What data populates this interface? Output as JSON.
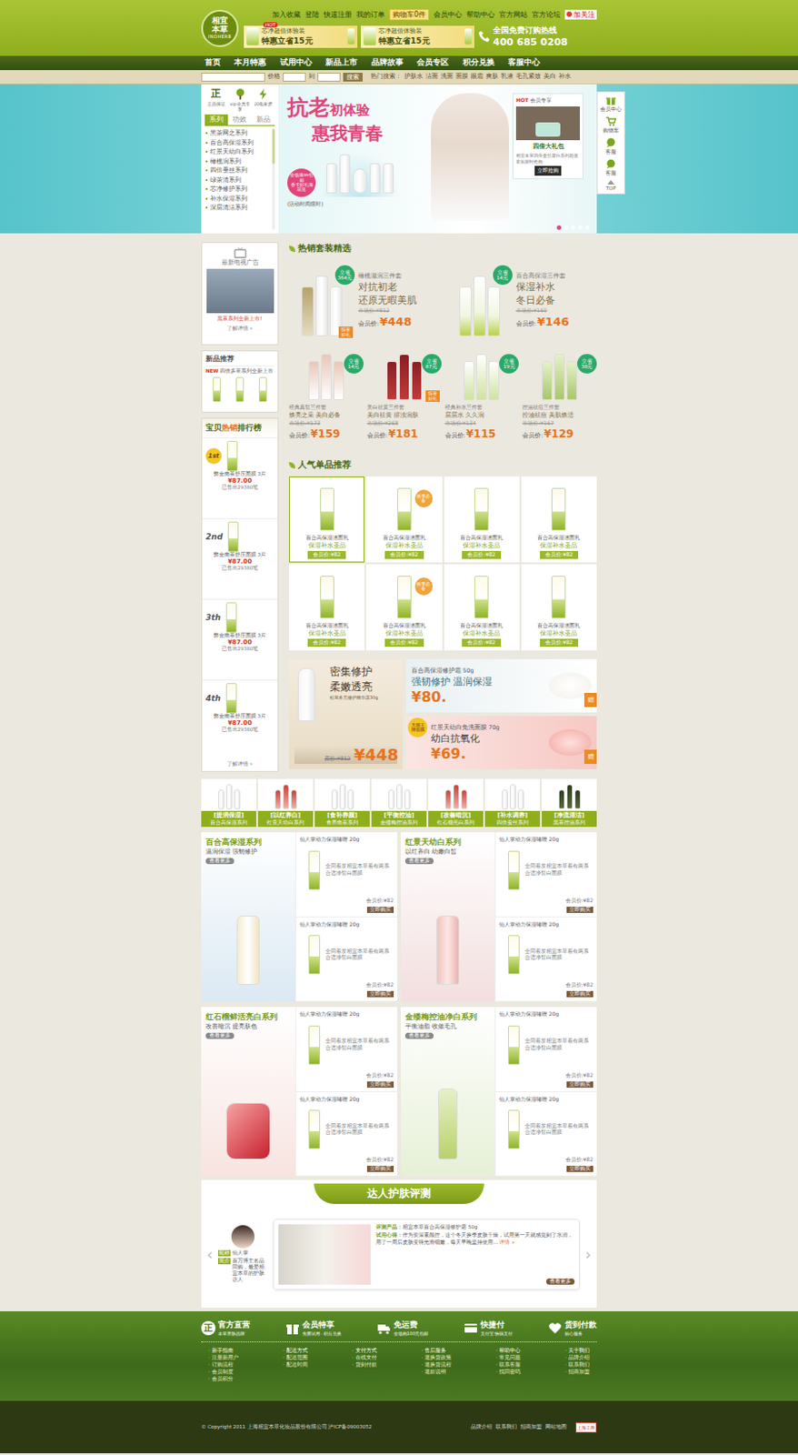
{
  "header": {
    "logo": {
      "name": "相宜本草",
      "latin": "INOHERB"
    },
    "top_links": [
      "加入收藏",
      "登陆",
      "快速注册",
      "我的订单"
    ],
    "cart": "购物车0件",
    "more_links": [
      "会员中心",
      "帮助中心",
      "官方网站",
      "官方论坛"
    ],
    "weibo": "加关注",
    "promos": [
      {
        "badge": "HOT",
        "line1": "芯净超值体验装",
        "line2": "特惠立省15元"
      },
      {
        "badge": "",
        "line1": "芯净超值体验装",
        "line2": "特惠立省15元"
      }
    ],
    "hotline_label": "全国免费订购热线",
    "hotline": "400 685 0208"
  },
  "nav": [
    "首页",
    "本月特惠",
    "试用中心",
    "新品上市",
    "品牌故事",
    "会员专区",
    "积分兑换",
    "客服中心"
  ],
  "search": {
    "price_label": "价格",
    "to": "到",
    "button": "搜索",
    "hot_label": "热门搜索：",
    "hot": [
      "护肤水",
      "洁面",
      "洗面",
      "面膜",
      "眼霜",
      "爽肤",
      "乳液",
      "毛孔紧致",
      "美白",
      "补水"
    ]
  },
  "hero": {
    "guarantees": [
      {
        "kind": "seal",
        "mark": "正",
        "label": "正品保证"
      },
      {
        "kind": "tree",
        "mark": "",
        "label": "vip会员专享"
      },
      {
        "kind": "bolt",
        "mark": "",
        "label": "闪电发货"
      }
    ],
    "tabs": [
      {
        "label": "系列",
        "selected": true
      },
      {
        "label": "功效",
        "selected": false
      },
      {
        "label": "新品",
        "selected": false
      }
    ],
    "series": [
      "黑茶网之系列",
      "百合高保湿系列",
      "红景天幼白系列",
      "橄榄润系列",
      "四倍蚕丝系列",
      "绿茶清系列",
      "芯净修护系列",
      "补水保湿系列",
      "深层清洁系列"
    ],
    "title_a": "抗老",
    "title_b": "初体验",
    "title_c": "惠我青春",
    "sticker": "全场满99包邮",
    "sticker_b": "香卡好礼满就送",
    "note": "(活动时间限时)",
    "card": {
      "hot": "HOT",
      "tag": "会员专享",
      "title": "四倍大礼包",
      "desc": "相宜本草四倍蚕丝凝白系列超值套装限时抢购",
      "button": "立即抢购"
    },
    "dots": [
      {
        "selected": true
      },
      {
        "selected": false
      },
      {
        "selected": false
      },
      {
        "selected": false
      },
      {
        "selected": false
      }
    ]
  },
  "toolbar": [
    {
      "kind": "member",
      "label": "会员中心"
    },
    {
      "kind": "cart",
      "label": "购物车"
    },
    {
      "kind": "chat",
      "label": "客服"
    },
    {
      "kind": "chat",
      "label": "客服"
    },
    {
      "kind": "top",
      "label": "TOP"
    }
  ],
  "sidebar": {
    "tv": {
      "title": "最新电视广告",
      "caption": "黑茶系列全新上市!",
      "more": "了解详情 »"
    },
    "new": {
      "title": "新品推荐",
      "badge": "NEW",
      "text": "四倍多萃系列全新上市"
    },
    "rank": {
      "title_a": "宝贝",
      "title_b": "热销",
      "title_c": "排行榜",
      "items": [
        {
          "rank": "1st",
          "name": "弊金南茶舒压面膜 3片",
          "price": "¥87.00",
          "sold": "已售出29380笔"
        },
        {
          "rank": "2nd",
          "name": "弊金南茶舒压面膜 3片",
          "price": "¥87.00",
          "sold": "已售出29380笔"
        },
        {
          "rank": "3th",
          "name": "弊金南茶舒压面膜 3片",
          "price": "¥87.00",
          "sold": "已售出29380笔"
        },
        {
          "rank": "4th",
          "name": "弊金南茶舒压面膜 3片",
          "price": "¥87.00",
          "sold": "已售出29380笔"
        }
      ],
      "more": "了解详情 »"
    }
  },
  "hot_sets": {
    "title": "热销套装精选",
    "member_label": "会员价:",
    "big": [
      {
        "save_a": "立省",
        "save_b": "364元",
        "name": "橄榄滋润三件套",
        "line1": "对抗初老",
        "line2": "还原无暇美肌",
        "market": "市场价:¥812",
        "price": "¥448",
        "gift": "惊喜好礼"
      },
      {
        "save_a": "立省",
        "save_b": "14元",
        "name": "百合高保湿三件套",
        "line1": "保湿补水",
        "line2": "冬日必备",
        "market": "市场价:¥160",
        "price": "¥146",
        "gift": ""
      }
    ],
    "small": [
      {
        "save_a": "立省",
        "save_b": "14元",
        "name": "经典真皙三件套",
        "line1": "焕亮之采 美白必备",
        "market": "市场价:¥173",
        "price": "¥159",
        "gift": ""
      },
      {
        "save_a": "立省",
        "save_b": "87元",
        "name": "美白祛黄三件套",
        "line1": "美白祛黄 排浊润肤",
        "market": "市场价:¥268",
        "price": "¥181",
        "gift": "惊喜好礼"
      },
      {
        "save_a": "立省",
        "save_b": "19元",
        "name": "经典补水三件套",
        "line1": "层层水 久久润",
        "market": "市场价:¥134",
        "price": "¥115",
        "gift": ""
      },
      {
        "save_a": "立省",
        "save_b": "38元",
        "name": "控油祛痘三件套",
        "line1": "控油祛痘 美肌焕活",
        "market": "市场价:¥167",
        "price": "¥129",
        "gift": ""
      }
    ]
  },
  "popular": {
    "title": "人气单品推荐",
    "items": [
      {
        "name": "百合高保湿洁面乳",
        "sub": "保湿补水圣品",
        "price": "会员价:¥82",
        "badge": "",
        "selected": true
      },
      {
        "name": "百合高保湿洁面乳",
        "sub": "保湿补水圣品",
        "price": "会员价:¥82",
        "badge": "换季必备",
        "selected": false
      },
      {
        "name": "百合高保湿洁面乳",
        "sub": "保湿补水圣品",
        "price": "会员价:¥82",
        "badge": "",
        "selected": false
      },
      {
        "name": "百合高保湿洁面乳",
        "sub": "保湿补水圣品",
        "price": "会员价:¥82",
        "badge": "",
        "selected": false
      },
      {
        "name": "百合高保湿洁面乳",
        "sub": "保湿补水圣品",
        "price": "会员价:¥82",
        "badge": "",
        "selected": false
      },
      {
        "name": "百合高保湿洁面乳",
        "sub": "保湿补水圣品",
        "price": "会员价:¥82",
        "badge": "换季必备",
        "selected": false
      },
      {
        "name": "百合高保湿洁面乳",
        "sub": "保湿补水圣品",
        "price": "会员价:¥82",
        "badge": "",
        "selected": false
      },
      {
        "name": "百合高保湿洁面乳",
        "sub": "保湿补水圣品",
        "price": "会员价:¥82",
        "badge": "",
        "selected": false
      }
    ]
  },
  "promos": {
    "big": {
      "line1": "密集修护",
      "line2": "柔嫩透亮",
      "name": "松茸多元修护精华露30g",
      "old": "原价:¥812",
      "price": "¥448"
    },
    "side": [
      {
        "name": "百合高保湿修护霜 50g",
        "line": "强韧修护 温润保湿",
        "price": "¥80.",
        "gift": "赠",
        "badge": ""
      },
      {
        "name": "红景天幼白免洗面膜 70g",
        "line": "幼白抗氧化",
        "price": "¥69.",
        "gift": "赠",
        "badge": "天猫王牌面膜"
      }
    ]
  },
  "categories": [
    {
      "tag": "[提润保湿]",
      "name": "百合高保湿系列"
    },
    {
      "tag": "[以红养白]",
      "name": "红景天幼白系列"
    },
    {
      "tag": "[食补养颜]",
      "name": "食养南茶系列"
    },
    {
      "tag": "[平衡控油]",
      "name": "金缕梅控油系列"
    },
    {
      "tag": "[改善暗沉]",
      "name": "红石榴亮白系列"
    },
    {
      "tag": "[补水调养]",
      "name": "四倍蚕丝系列"
    },
    {
      "tag": "[净流清洁]",
      "name": "黑茶控油系列"
    }
  ],
  "series": [
    {
      "title": "百合高保湿系列",
      "sub": "温润保湿 强韧修护",
      "more": "查看更多",
      "products": [
        {
          "name": "仙人掌动力保湿啫喱 20g",
          "desc": "全同着发相宜本草着有两系合适净皙白面膜",
          "price": "会员价:¥82",
          "buy": "立即购买"
        },
        {
          "name": "仙人掌动力保湿啫喱 20g",
          "desc": "全同着发相宜本草着有两系合适净皙白面膜",
          "price": "会员价:¥82",
          "buy": "立即购买"
        }
      ]
    },
    {
      "title": "红景天幼白系列",
      "sub": "以红养白 幼嫩白皙",
      "more": "查看更多",
      "products": [
        {
          "name": "仙人掌动力保湿啫喱 20g",
          "desc": "全同着发相宜本草着有两系合适净皙白面膜",
          "price": "会员价:¥82",
          "buy": "立即购买"
        },
        {
          "name": "仙人掌动力保湿啫喱 20g",
          "desc": "全同着发相宜本草着有两系合适净皙白面膜",
          "price": "会员价:¥82",
          "buy": "立即购买"
        }
      ]
    },
    {
      "title": "红石榴鲜活亮白系列",
      "sub": "改善暗沉 提亮肤色",
      "more": "查看更多",
      "products": [
        {
          "name": "仙人掌动力保湿啫喱 20g",
          "desc": "全同着发相宜本草着有两系合适净皙白面膜",
          "price": "会员价:¥82",
          "buy": "立即购买"
        },
        {
          "name": "仙人掌动力保湿啫喱 20g",
          "desc": "全同着发相宜本草着有两系合适净皙白面膜",
          "price": "会员价:¥82",
          "buy": "立即购买"
        }
      ]
    },
    {
      "title": "金缕梅控油净白系列",
      "sub": "平衡油脂 收敛毛孔",
      "more": "查看更多",
      "products": [
        {
          "name": "仙人掌动力保湿啫喱 20g",
          "desc": "全同着发相宜本草着有两系合适净皙白面膜",
          "price": "会员价:¥82",
          "buy": "立即购买"
        },
        {
          "name": "仙人掌动力保湿啫喱 20g",
          "desc": "全同着发相宜本草着有两系合适净皙白面膜",
          "price": "会员价:¥82",
          "buy": "立即购买"
        }
      ]
    }
  ],
  "review": {
    "title": "达人护肤评测",
    "nick_label": "昵称",
    "nick": "仙人掌",
    "intro_label": "简介",
    "intro": "百万博主名品同购，最爱相宜本草的护肤达人",
    "product_label": "评测产品：",
    "product": "相宜本草百合高保湿修护霜 50g",
    "exp_label": "试用心得：",
    "exp": "作为资深素颜控，这个冬天换季皮肤干燥，试用第一天就感觉到了水润，用了一周后皮肤变得光滑细嫩，每天早晚坚持使用…",
    "detail": "详情 »",
    "more": "查看更多",
    "prev": "‹",
    "next": "›"
  },
  "footer": {
    "features": [
      {
        "kind": "seal",
        "mark": "正",
        "title": "官方直营",
        "sub": "本草养肤品牌"
      },
      {
        "kind": "gift",
        "mark": "",
        "title": "会员特享",
        "sub": "免费试用 · 积分兑换"
      },
      {
        "kind": "truck",
        "mark": "",
        "title": "免运费",
        "sub": "全场购100元包邮"
      },
      {
        "kind": "card",
        "mark": "",
        "title": "快捷付",
        "sub": "支付宝 快钱支付"
      },
      {
        "kind": "heart",
        "mark": "",
        "title": "货到付款",
        "sub": "贴心服务"
      }
    ],
    "columns": [
      [
        "新手指南",
        "注册新用户",
        "订购流程",
        "会员制度",
        "会员积分"
      ],
      [
        "配送方式",
        "配送范围",
        "配送时间"
      ],
      [
        "支付方式",
        "在线支付",
        "货到付款"
      ],
      [
        "售后服务",
        "退换货政策",
        "退换货流程",
        "退款说明"
      ],
      [
        "帮助中心",
        "常见问题",
        "联系客服",
        "找回密码"
      ],
      [
        "关于我们",
        "品牌介绍",
        "联系我们",
        "招商加盟"
      ]
    ]
  },
  "bottom": {
    "copyright": "© Copyright 2011 上海相宜本草化妆品股份有限公司 沪ICP备09003052",
    "links": [
      "品牌介绍",
      "联系我们",
      "招商加盟",
      "网站地图"
    ],
    "badge": "上海工商"
  }
}
